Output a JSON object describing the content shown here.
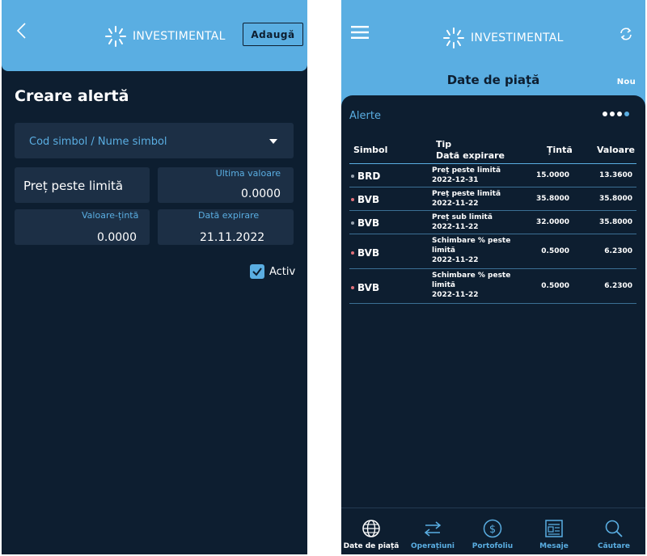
{
  "brand": {
    "logo_text": "INVESTIMENTAL"
  },
  "create_alert": {
    "add_button": "Adaugă",
    "title": "Creare alertă",
    "symbol_placeholder": "Cod simbol / Nume simbol",
    "alert_type": "Preț peste limită",
    "last_value_label": "Ultima valoare",
    "last_value": "0.0000",
    "target_label": "Valoare-țintă",
    "target_value": "0.0000",
    "expiry_label": "Dată expirare",
    "expiry_value": "21.11.2022",
    "active_label": "Activ",
    "active_checked": true
  },
  "market": {
    "title": "Date de piață",
    "new_button": "Nou",
    "section_title": "Alerte",
    "page_dots": 4,
    "active_dot": 3,
    "columns": {
      "symbol": "Simbol",
      "type": "Tip",
      "expiry": "Dată expirare",
      "target": "Țintă",
      "value": "Valoare"
    },
    "alerts": [
      {
        "symbol": "BRD",
        "type": "Preț peste limită",
        "expiry": "2022-12-31",
        "target": "15.0000",
        "value": "13.3600",
        "dot_color": "#9aa5b1"
      },
      {
        "symbol": "BVB",
        "type": "Preț peste limită",
        "expiry": "2022-11-22",
        "target": "35.8000",
        "value": "35.8000",
        "dot_color": "#e0707a"
      },
      {
        "symbol": "BVB",
        "type": "Preț sub limită",
        "expiry": "2022-11-22",
        "target": "32.0000",
        "value": "35.8000",
        "dot_color": "#9aa5b1"
      },
      {
        "symbol": "BVB",
        "type_line1": "Schimbare % peste",
        "type_line2": "limită",
        "expiry": "2022-11-22",
        "target": "0.5000",
        "value": "6.2300",
        "dot_color": "#e0707a"
      },
      {
        "symbol": "BVB",
        "type_line1": "Schimbare % peste",
        "type_line2": "limită",
        "expiry": "2022-11-22",
        "target": "0.5000",
        "value": "6.2300",
        "dot_color": "#e0707a"
      }
    ]
  },
  "tabs": [
    {
      "label": "Date de piață",
      "icon": "globe-icon",
      "selected": true
    },
    {
      "label": "Operațiuni",
      "icon": "arrows-exchange-icon",
      "selected": false
    },
    {
      "label": "Portofoliu",
      "icon": "dollar-circle-icon",
      "selected": false
    },
    {
      "label": "Mesaje",
      "icon": "newspaper-icon",
      "selected": false
    },
    {
      "label": "Căutare",
      "icon": "search-icon",
      "selected": false
    }
  ],
  "colors": {
    "header": "#5aaee2",
    "background": "#0d1e30",
    "field": "#1c2f45",
    "accent": "#5aaee2"
  }
}
